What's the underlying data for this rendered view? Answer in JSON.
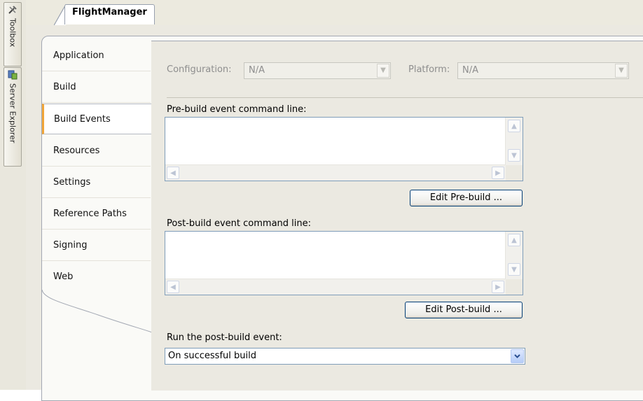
{
  "side_toolbars": {
    "toolbox_label": "Toolbox",
    "server_explorer_label": "Server Explorer"
  },
  "document": {
    "tab_title": "FlightManager"
  },
  "nav": {
    "items": [
      {
        "label": "Application"
      },
      {
        "label": "Build"
      },
      {
        "label": "Build Events"
      },
      {
        "label": "Resources"
      },
      {
        "label": "Settings"
      },
      {
        "label": "Reference Paths"
      },
      {
        "label": "Signing"
      },
      {
        "label": "Web"
      }
    ],
    "active": "Build Events"
  },
  "config_row": {
    "configuration_label": "Configuration:",
    "configuration_value": "N/A",
    "platform_label": "Platform:",
    "platform_value": "N/A"
  },
  "pre_build": {
    "label": "Pre-build event command line:",
    "value": "",
    "button_label": "Edit Pre-build ..."
  },
  "post_build": {
    "label": "Post-build event command line:",
    "value": "",
    "button_label": "Edit Post-build ..."
  },
  "run_post_build": {
    "label": "Run the post-build event:",
    "selected": "On successful build"
  },
  "colors": {
    "active_tab_accent": "#f1a63a",
    "panel_background": "#ebe9e1",
    "input_border": "#7f9db9"
  }
}
